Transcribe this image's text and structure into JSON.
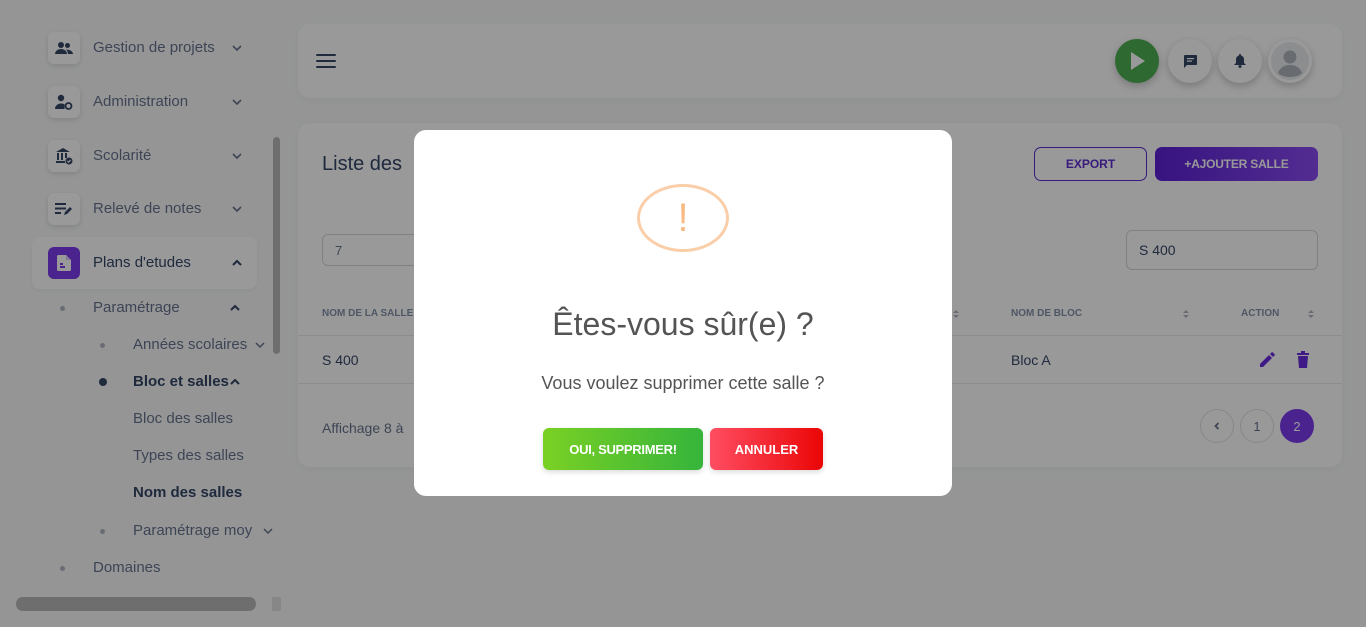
{
  "sidebar": {
    "items": [
      {
        "label": "Gestion de projets",
        "icon": "people-icon"
      },
      {
        "label": "Administration",
        "icon": "user-gear-icon"
      },
      {
        "label": "Scolarité",
        "icon": "institution-icon"
      },
      {
        "label": "Relevé de notes",
        "icon": "notes-edit-icon"
      },
      {
        "label": "Plans d'etudes",
        "icon": "document-icon"
      }
    ],
    "sub": {
      "parametrage": "Paramétrage",
      "annees": "Années scolaires",
      "bloc_salles": "Bloc et salles",
      "bloc_des_salles": "Bloc des salles",
      "types_salles": "Types des salles",
      "nom_salles": "Nom des salles",
      "param_moy": "Paramétrage moy",
      "domaines": "Domaines"
    }
  },
  "card": {
    "title": "Liste des",
    "export_label": "EXPORT",
    "add_label": "+AJOUTER SALLE",
    "entries_value": "7",
    "search_value": "S 400",
    "columns": {
      "nom_salle": "NOM DE LA SALLE",
      "nom_bloc": "NOM DE BLOC",
      "action": "ACTION"
    },
    "row": {
      "salle": "S 400",
      "bloc": "Bloc A"
    },
    "info": "Affichage 8 à",
    "pages": [
      "1",
      "2"
    ],
    "current_page": "2"
  },
  "modal": {
    "title": "Êtes-vous sûr(e) ?",
    "text": "Vous voulez supprimer cette salle ?",
    "warning_glyph": "!",
    "confirm_label": "OUI, SUPPRIMER!",
    "cancel_label": "ANNULER"
  },
  "colors": {
    "accent": "#7e3bef",
    "confirm": "#4cbb2f",
    "cancel": "#f5182a",
    "warning": "#f8bb86"
  }
}
